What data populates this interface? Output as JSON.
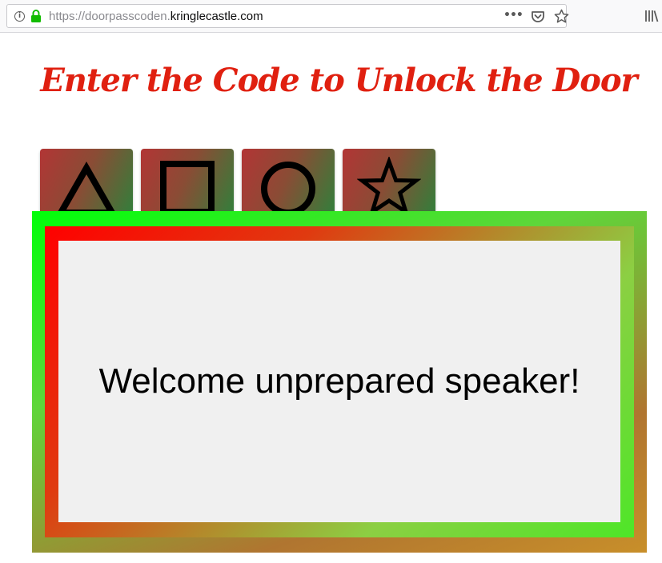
{
  "browser": {
    "url_prefix": "https://doorpasscoden.",
    "url_domain": "kringlecastle.com",
    "more_glyph": "•••"
  },
  "page": {
    "title": "Enter the Code to Unlock the Door",
    "message": "Welcome unprepared speaker!"
  },
  "symbols": [
    {
      "name": "triangle"
    },
    {
      "name": "square"
    },
    {
      "name": "circle"
    },
    {
      "name": "star"
    }
  ],
  "colors": {
    "title": "#e02010",
    "button_start": "#b23535",
    "button_end": "#3a7a3a",
    "frame_green": "#00ff0a",
    "frame_red": "#ff0000",
    "panel": "#f0f0f0"
  }
}
